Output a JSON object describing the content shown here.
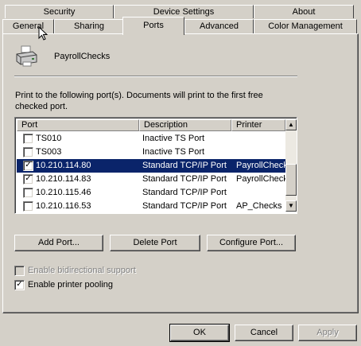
{
  "tabs_back": [
    {
      "label": "Security",
      "name": "tab-security"
    },
    {
      "label": "Device Settings",
      "name": "tab-device-settings"
    },
    {
      "label": "About",
      "name": "tab-about"
    }
  ],
  "tabs_front": [
    {
      "label": "General",
      "name": "tab-general"
    },
    {
      "label": "Sharing",
      "name": "tab-sharing"
    },
    {
      "label": "Ports",
      "name": "tab-ports",
      "selected": true
    },
    {
      "label": "Advanced",
      "name": "tab-advanced"
    },
    {
      "label": "Color Management",
      "name": "tab-color-management"
    }
  ],
  "printer": {
    "name": "PayrollChecks",
    "icon": "printer-icon"
  },
  "instructions": "Print to the following port(s). Documents will print to the first free checked port.",
  "ports": {
    "columns": [
      "Port",
      "Description",
      "Printer"
    ],
    "rows": [
      {
        "port": "TS010",
        "description": "Inactive TS Port",
        "printer": "",
        "checked": false,
        "selected": false
      },
      {
        "port": "TS003",
        "description": "Inactive TS Port",
        "printer": "",
        "checked": false,
        "selected": false
      },
      {
        "port": "10.210.114.80",
        "description": "Standard TCP/IP Port",
        "printer": "PayrollChecks",
        "checked": true,
        "selected": true
      },
      {
        "port": "10.210.114.83",
        "description": "Standard TCP/IP Port",
        "printer": "PayrollChecks",
        "checked": true,
        "selected": false
      },
      {
        "port": "10.210.115.46",
        "description": "Standard TCP/IP Port",
        "printer": "",
        "checked": false,
        "selected": false
      },
      {
        "port": "10.210.116.53",
        "description": "Standard TCP/IP Port",
        "printer": "AP_Checks",
        "checked": false,
        "selected": false
      }
    ]
  },
  "port_buttons": {
    "add": "Add Port...",
    "delete": "Delete Port",
    "configure": "Configure Port..."
  },
  "options": {
    "bidirectional": {
      "label": "Enable bidirectional support",
      "checked": false,
      "enabled": false
    },
    "pooling": {
      "label": "Enable printer pooling",
      "checked": true,
      "enabled": true
    }
  },
  "dialog_buttons": {
    "ok": "OK",
    "cancel": "Cancel",
    "apply": "Apply"
  },
  "colors": {
    "selection": "#0a246a",
    "face": "#d4d0c8"
  }
}
